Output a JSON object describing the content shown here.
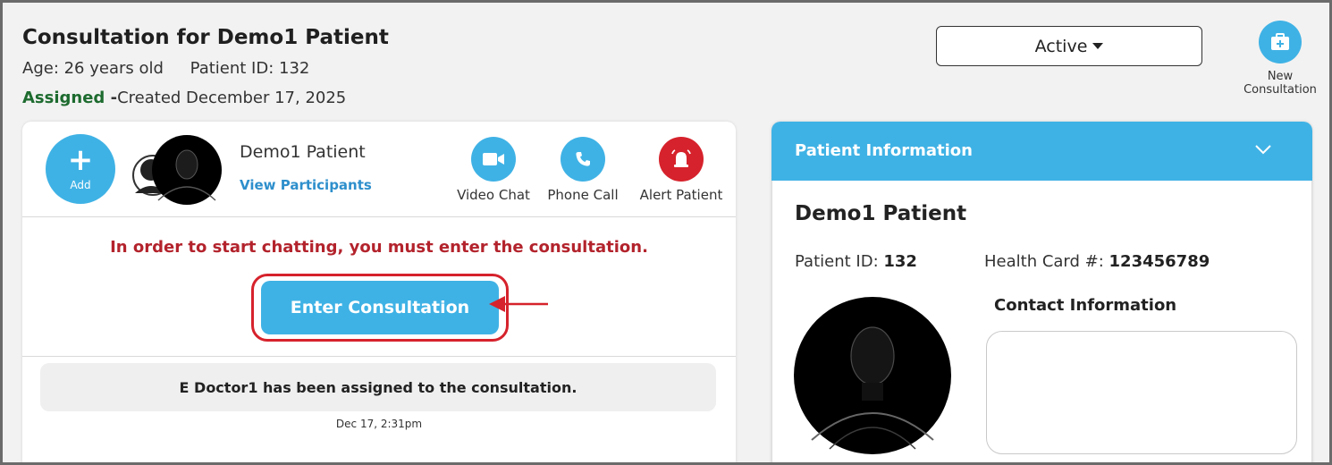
{
  "header": {
    "title": "Consultation for Demo1 Patient",
    "age": "Age: 26 years old",
    "patient_id": "Patient ID: 132",
    "assigned": "Assigned",
    "dash": " -",
    "created": "Created December 17, 2025",
    "status_value": "Active",
    "new_consult_line1": "New",
    "new_consult_line2": "Consultation"
  },
  "chat_panel": {
    "add_label": "Add",
    "patient_name": "Demo1 Patient",
    "view_participants": "View Participants",
    "actions": {
      "video": "Video Chat",
      "phone": "Phone Call",
      "alert": "Alert Patient"
    },
    "warning": "In order to start chatting, you must enter the consultation.",
    "enter_button": "Enter Consultation",
    "system_message": "E Doctor1 has been assigned to the consultation.",
    "system_time": "Dec 17, 2:31pm"
  },
  "patient_info": {
    "section_title": "Patient Information",
    "name": "Demo1 Patient",
    "pid_label": "Patient ID: ",
    "pid_value": "132",
    "hc_label": "Health Card #: ",
    "hc_value": "123456789",
    "contact_title": "Contact Information"
  },
  "colors": {
    "accent": "#3fb2e5",
    "alert": "#d6222c",
    "assigned_green": "#1d6b2f",
    "warning_red": "#b3232c"
  },
  "icons": [
    "briefcase-plus-icon",
    "plus-icon",
    "video-camera-icon",
    "phone-icon",
    "alarm-bell-icon",
    "chevron-down-icon",
    "arrow-left-icon"
  ]
}
